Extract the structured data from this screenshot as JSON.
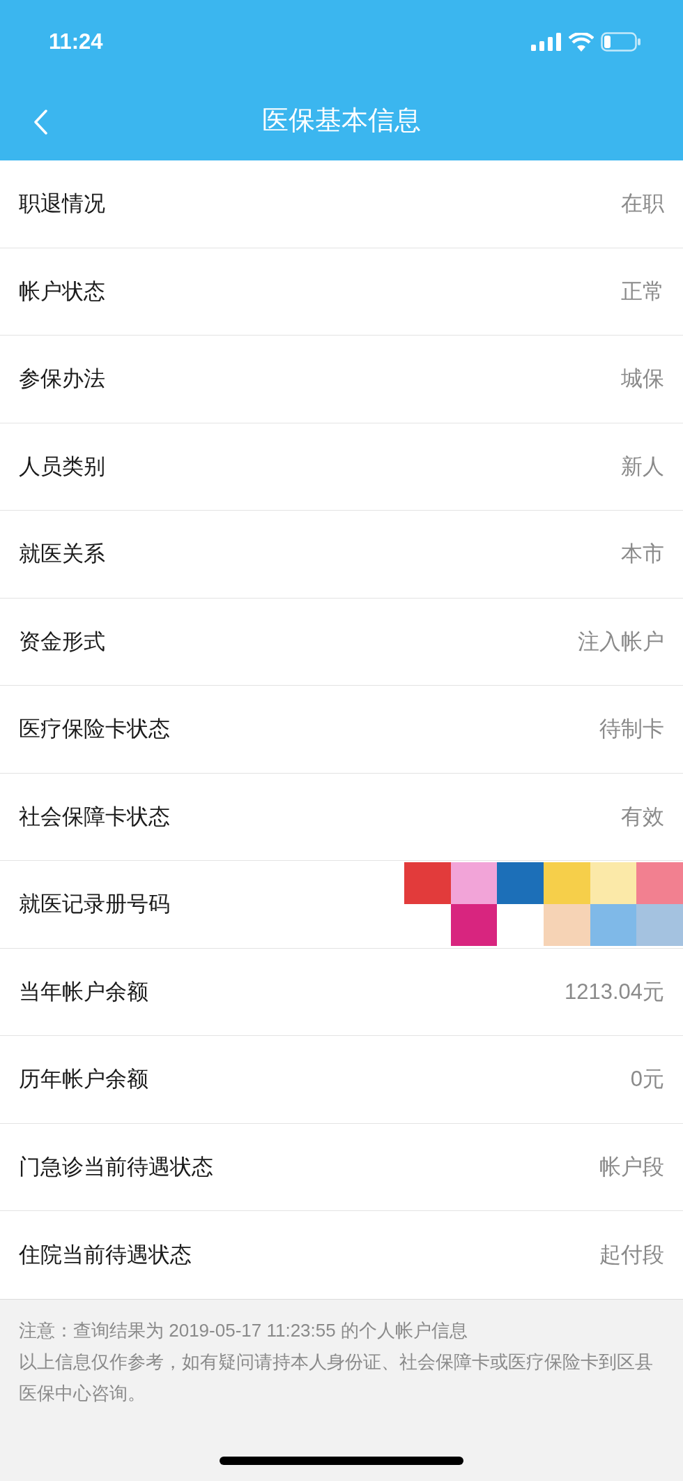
{
  "status_bar": {
    "time": "11:24"
  },
  "nav_bar": {
    "title": "医保基本信息"
  },
  "rows": [
    {
      "kind": "text",
      "label": "职退情况",
      "value": "在职"
    },
    {
      "kind": "text",
      "label": "帐户状态",
      "value": "正常"
    },
    {
      "kind": "text",
      "label": "参保办法",
      "value": "城保"
    },
    {
      "kind": "text",
      "label": "人员类别",
      "value": "新人"
    },
    {
      "kind": "text",
      "label": "就医关系",
      "value": "本市"
    },
    {
      "kind": "text",
      "label": "资金形式",
      "value": "注入帐户"
    },
    {
      "kind": "text",
      "label": "医疗保险卡状态",
      "value": "待制卡"
    },
    {
      "kind": "text",
      "label": "社会保障卡状态",
      "value": "有效"
    },
    {
      "kind": "redacted",
      "label": "就医记录册号码"
    },
    {
      "kind": "text",
      "label": "当年帐户余额",
      "value": "1213.04元"
    },
    {
      "kind": "text",
      "label": "历年帐户余额",
      "value": "0元"
    },
    {
      "kind": "text",
      "label": "门急诊当前待遇状态",
      "value": "帐户段"
    },
    {
      "kind": "text",
      "label": "住院当前待遇状态",
      "value": "起付段"
    }
  ],
  "footer": {
    "lines": [
      "注意：查询结果为 2019-05-17 11:23:55 的个人帐户信息",
      "以上信息仅作参考，如有疑问请持本人身份证、社会保障卡或医疗保险卡到区县医保中心咨询。"
    ]
  }
}
